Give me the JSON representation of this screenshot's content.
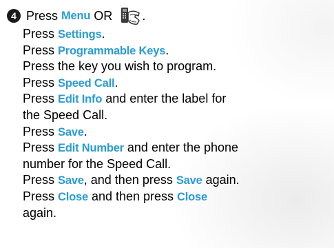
{
  "step": {
    "number": "4",
    "press": "Press ",
    "menu": "Menu",
    "or": " OR ",
    "end": ".",
    "icon": "phone-handset-icon"
  },
  "lines": [
    {
      "pre": "Press ",
      "kw": "Settings",
      "post": "."
    },
    {
      "pre": "Press ",
      "kw": "Programmable Keys",
      "post": "."
    },
    {
      "pre": "Press the key you wish to program.",
      "kw": "",
      "post": ""
    },
    {
      "pre": "Press ",
      "kw": "Speed Call",
      "post": "."
    },
    {
      "pre": "Press ",
      "kw": "Edit Info",
      "post": " and enter the label for"
    },
    {
      "pre": "the Speed Call.",
      "kw": "",
      "post": ""
    },
    {
      "pre": "Press ",
      "kw": "Save",
      "post": "."
    },
    {
      "pre": "Press ",
      "kw": "Edit Number",
      "post": " and enter the phone"
    },
    {
      "pre": "number for the Speed Call.",
      "kw": "",
      "post": ""
    },
    {
      "pre": "Press ",
      "kw": "Save",
      "post": ", and then press ",
      "kw2": "Save",
      "post2": " again."
    },
    {
      "pre": "Press ",
      "kw": "Close",
      "post": " and then press ",
      "kw2": "Close",
      "post2": ""
    },
    {
      "pre": "again.",
      "kw": "",
      "post": ""
    }
  ],
  "colors": {
    "keyword": "#2a9bd6",
    "text": "#000000"
  }
}
